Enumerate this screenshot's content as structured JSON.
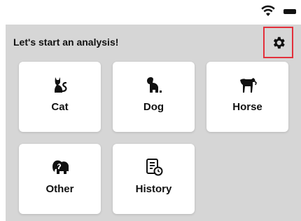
{
  "status_bar": {
    "icons": [
      "wifi-icon",
      "battery-icon"
    ]
  },
  "prompt": "Let's start an analysis!",
  "settings": {
    "icon": "gear-icon",
    "highlight_color": "#e3303b"
  },
  "tiles": [
    {
      "label": "Cat",
      "icon": "cat-icon"
    },
    {
      "label": "Dog",
      "icon": "dog-icon"
    },
    {
      "label": "Horse",
      "icon": "horse-icon"
    },
    {
      "label": "Other",
      "icon": "elephant-icon"
    },
    {
      "label": "History",
      "icon": "history-icon"
    }
  ],
  "colors": {
    "background": "#d6d6d6",
    "tile": "#ffffff",
    "text": "#111111"
  }
}
